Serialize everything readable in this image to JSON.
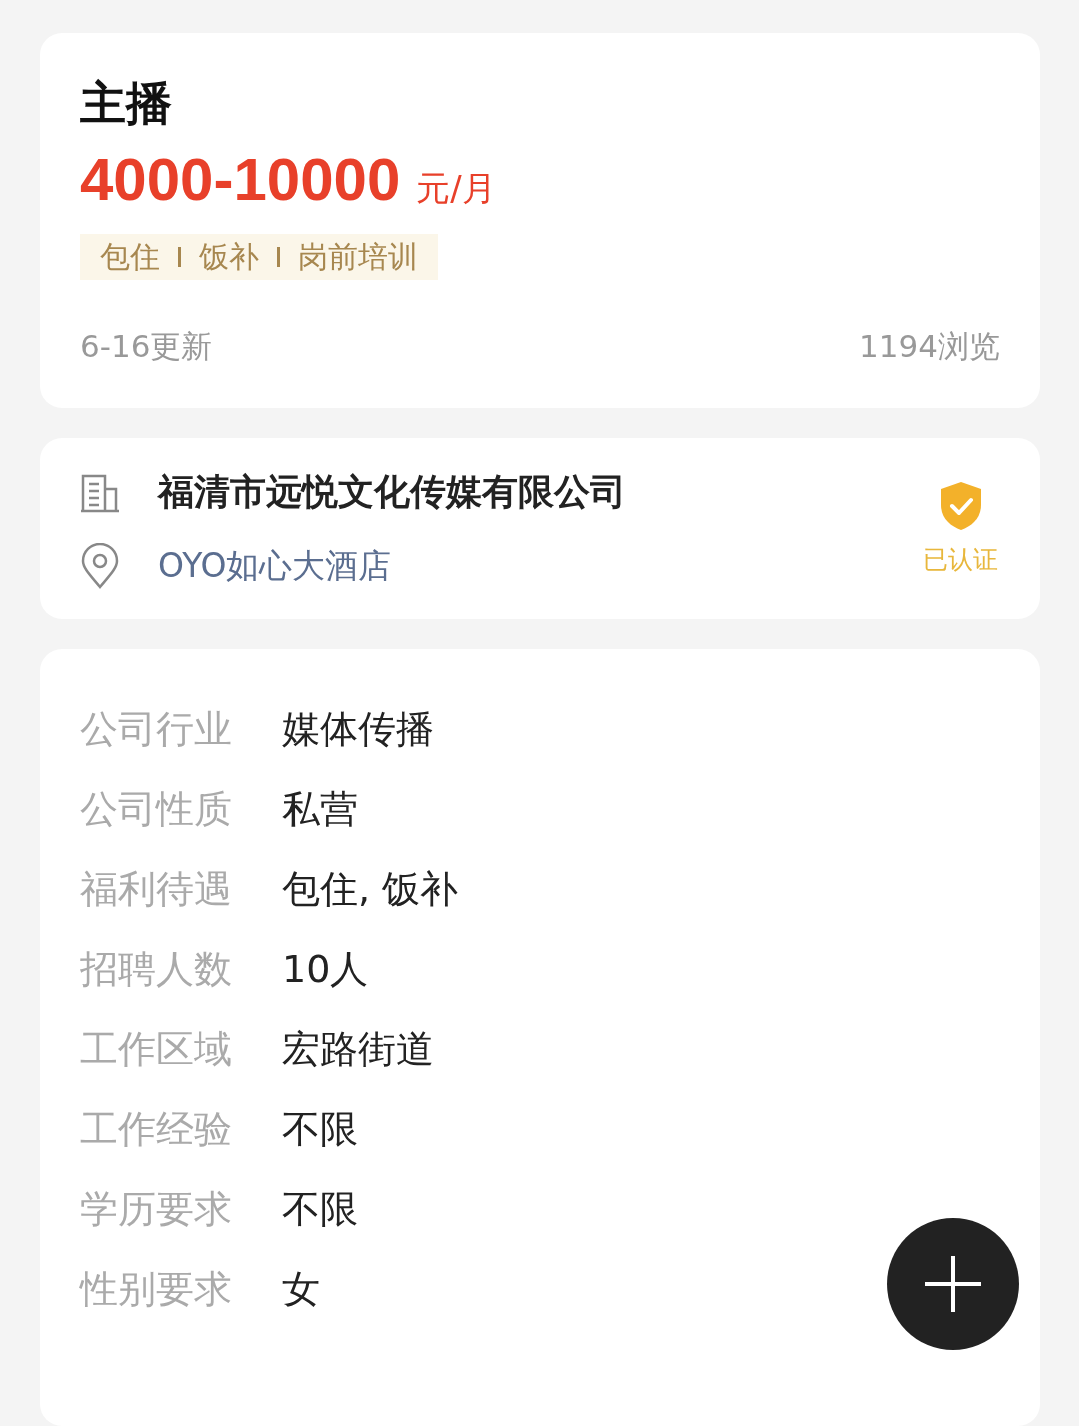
{
  "job": {
    "title": "主播",
    "salary": "4000-10000",
    "salary_unit": "元/月",
    "tags": [
      "包住",
      "饭补",
      "岗前培训"
    ],
    "updated": "6-16更新",
    "views": "1194浏览"
  },
  "company": {
    "name": "福清市远悦文化传媒有限公司",
    "location": "OYO如心大酒店",
    "verified": true,
    "verified_label": "已认证"
  },
  "details": [
    {
      "label": "公司行业",
      "value": "媒体传播"
    },
    {
      "label": "公司性质",
      "value": "私营"
    },
    {
      "label": "福利待遇",
      "value": "包住, 饭补"
    },
    {
      "label": "招聘人数",
      "value": "10人"
    },
    {
      "label": "工作区域",
      "value": "宏路街道"
    },
    {
      "label": "工作经验",
      "value": "不限"
    },
    {
      "label": "学历要求",
      "value": "不限"
    },
    {
      "label": "性别要求",
      "value": "女"
    }
  ]
}
